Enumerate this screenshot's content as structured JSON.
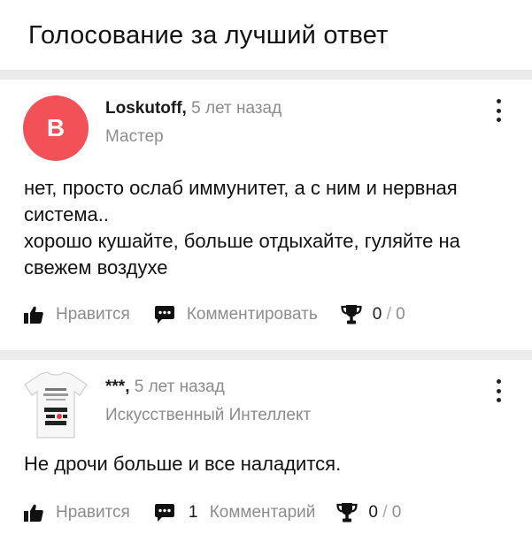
{
  "header": {
    "title": "Голосование за лучший ответ"
  },
  "answers": [
    {
      "avatar_letter": "B",
      "avatar_color": "#f25157",
      "author": "Loskutoff",
      "separator": ",",
      "time": " 5 лет назад",
      "rank": "Мастер",
      "text_lines": [
        "нет, просто ослаб иммунитет, а с ним и нервная система..",
        "хорошо кушайте, больше отдыхайте, гуляйте на свежем воздухе"
      ],
      "like_label": "Нравится",
      "comment_count": "",
      "comment_label": "Комментировать",
      "trophy_count": "0",
      "trophy_total": "0"
    },
    {
      "avatar_caption": "Скотина мерзкая... ОЧЕНЬ ХОРОШИЙ ДОКТОР",
      "author": "***",
      "separator": ",",
      "time": " 5 лет назад",
      "rank": "Искусственный Интеллект",
      "text_lines": [
        "Не дрочи больше и все наладится."
      ],
      "like_label": "Нравится",
      "comment_count": "1",
      "comment_label": "Комментарий",
      "trophy_count": "0",
      "trophy_total": "0"
    }
  ],
  "icons": {
    "like": "thumbs-up-icon",
    "comment": "comment-icon",
    "trophy": "trophy-icon",
    "menu": "more-vertical-icon"
  }
}
